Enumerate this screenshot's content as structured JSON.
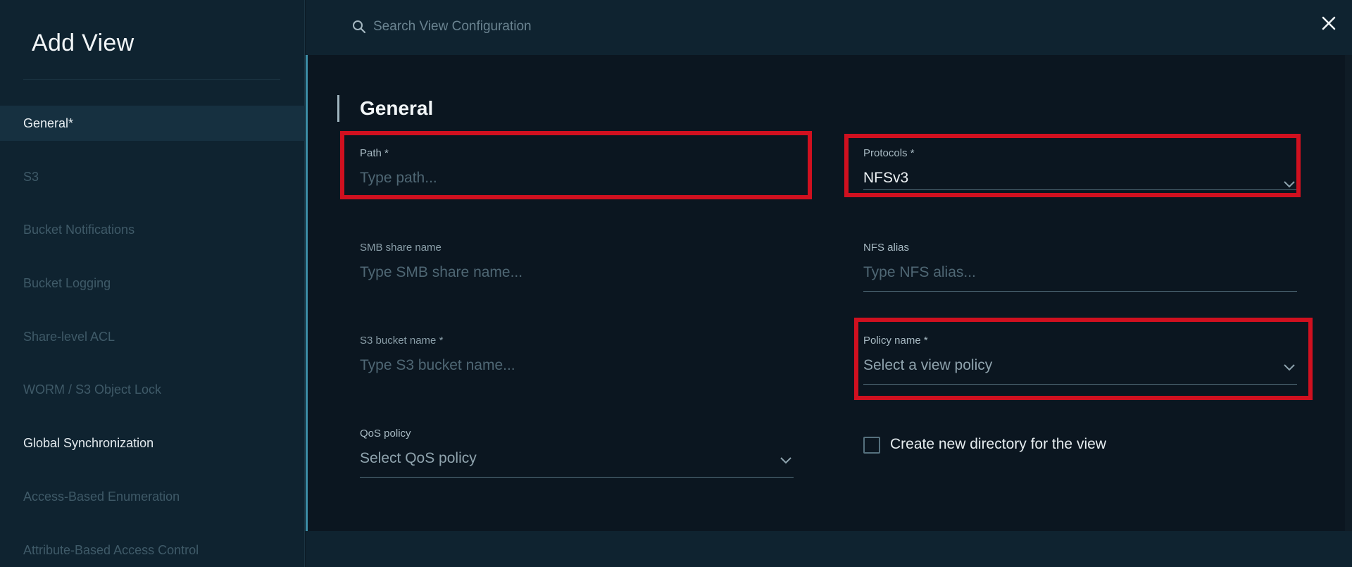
{
  "sidebar": {
    "title": "Add View",
    "items": [
      {
        "label": "General*",
        "state": "active"
      },
      {
        "label": "S3",
        "state": "disabled"
      },
      {
        "label": "Bucket Notifications",
        "state": "disabled"
      },
      {
        "label": "Bucket Logging",
        "state": "disabled"
      },
      {
        "label": "Share-level ACL",
        "state": "disabled"
      },
      {
        "label": "WORM / S3 Object Lock",
        "state": "disabled"
      },
      {
        "label": "Global Synchronization",
        "state": "enabled"
      },
      {
        "label": "Access-Based Enumeration",
        "state": "disabled"
      },
      {
        "label": "Attribute-Based Access Control",
        "state": "disabled"
      }
    ]
  },
  "search": {
    "placeholder": "Search View Configuration",
    "icon": "search-icon"
  },
  "close": {
    "icon": "close-icon"
  },
  "section": {
    "title": "General"
  },
  "fields": {
    "path": {
      "label": "Path *",
      "placeholder": "Type path..."
    },
    "protocols": {
      "label": "Protocols *",
      "value": "NFSv3"
    },
    "smb_share_name": {
      "label": "SMB share name",
      "placeholder": "Type SMB share name..."
    },
    "nfs_alias": {
      "label": "NFS alias",
      "placeholder": "Type NFS alias..."
    },
    "s3_bucket_name": {
      "label": "S3 bucket name *",
      "placeholder": "Type S3 bucket name..."
    },
    "policy_name": {
      "label": "Policy name *",
      "placeholder": "Select a view policy"
    },
    "qos_policy": {
      "label": "QoS policy",
      "placeholder": "Select QoS policy"
    },
    "create_directory": {
      "label": "Create new directory for the view",
      "checked": false
    }
  },
  "colors": {
    "highlight": "#d0101f",
    "accent": "#3d8fa8",
    "background": "#0b1620"
  }
}
